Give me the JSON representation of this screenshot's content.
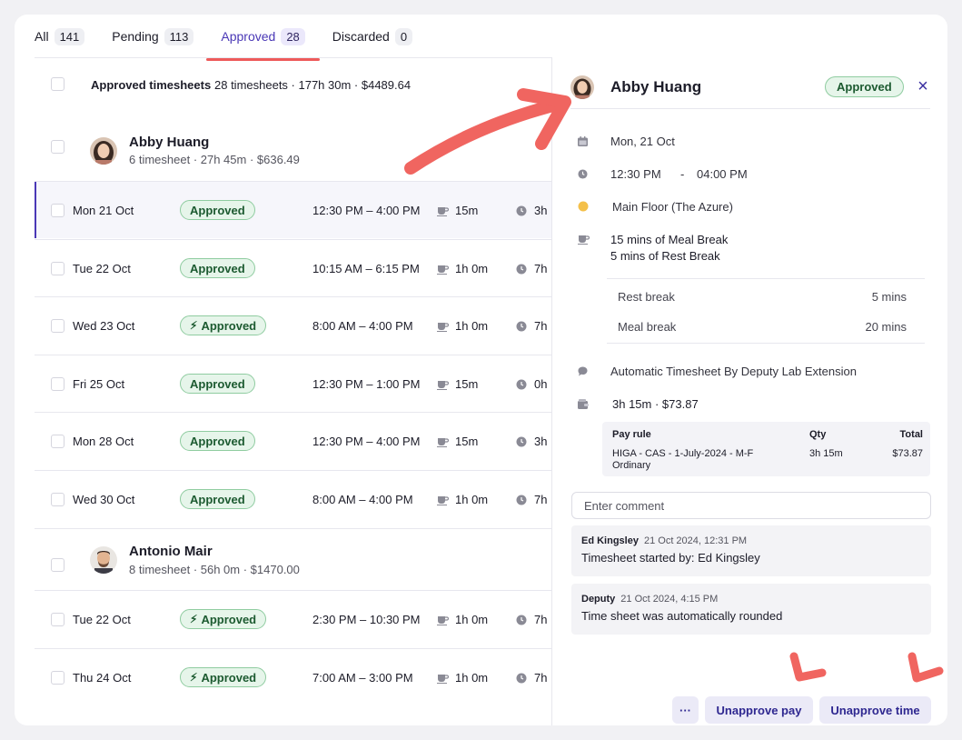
{
  "tabs": [
    {
      "label": "All",
      "count": "141"
    },
    {
      "label": "Pending",
      "count": "113"
    },
    {
      "label": "Approved",
      "count": "28"
    },
    {
      "label": "Discarded",
      "count": "0"
    }
  ],
  "summary": {
    "label": "Approved timesheets",
    "stats": "28 timesheets · 177h 30m · $4489.64"
  },
  "people": [
    {
      "name": "Abby Huang",
      "sub": "6 timesheet · 27h 45m · $636.49"
    },
    {
      "name": "Antonio Mair",
      "sub": "8 timesheet · 56h 0m · $1470.00"
    }
  ],
  "rows": [
    {
      "date": "Mon 21 Oct",
      "status": "Approved",
      "auto": false,
      "time": "12:30 PM – 4:00 PM",
      "break": "15m",
      "duration": "3h"
    },
    {
      "date": "Tue 22 Oct",
      "status": "Approved",
      "auto": false,
      "time": "10:15 AM – 6:15 PM",
      "break": "1h 0m",
      "duration": "7h"
    },
    {
      "date": "Wed 23 Oct",
      "status": "Approved",
      "auto": true,
      "time": "8:00 AM – 4:00 PM",
      "break": "1h 0m",
      "duration": "7h"
    },
    {
      "date": "Fri 25 Oct",
      "status": "Approved",
      "auto": false,
      "time": "12:30 PM – 1:00 PM",
      "break": "15m",
      "duration": "0h"
    },
    {
      "date": "Mon 28 Oct",
      "status": "Approved",
      "auto": false,
      "time": "12:30 PM – 4:00 PM",
      "break": "15m",
      "duration": "3h"
    },
    {
      "date": "Wed 30 Oct",
      "status": "Approved",
      "auto": false,
      "time": "8:00 AM – 4:00 PM",
      "break": "1h 0m",
      "duration": "7h"
    },
    {
      "date": "Tue 22 Oct",
      "status": "Approved",
      "auto": true,
      "time": "2:30 PM – 10:30 PM",
      "break": "1h 0m",
      "duration": "7h"
    },
    {
      "date": "Thu 24 Oct",
      "status": "Approved",
      "auto": true,
      "time": "7:00 AM – 3:00 PM",
      "break": "1h 0m",
      "duration": "7h"
    }
  ],
  "detail": {
    "name": "Abby Huang",
    "status": "Approved",
    "close": "×",
    "date": "Mon, 21 Oct",
    "start": "12:30 PM",
    "dash": "-",
    "end": "04:00 PM",
    "location": "Main Floor (The Azure)",
    "breaks_line1": "15 mins of Meal Break",
    "breaks_line2": "5 mins of Rest Break",
    "break_rows": [
      {
        "label": "Rest break",
        "value": "5 mins"
      },
      {
        "label": "Meal break",
        "value": "20 mins"
      }
    ],
    "note": "Automatic Timesheet By Deputy Lab Extension",
    "cost": "3h 15m  · $73.87",
    "pay_table": {
      "headers": {
        "rule": "Pay rule",
        "qty": "Qty",
        "total": "Total"
      },
      "rule_line1": "HIGA - CAS - 1-July-2024 - M-F",
      "rule_line2": "Ordinary",
      "qty": "3h 15m",
      "total": "$73.87"
    },
    "comment_placeholder": "Enter comment",
    "comments": [
      {
        "author": "Ed Kingsley",
        "when": "21 Oct 2024, 12:31 PM",
        "body": "Timesheet started by: Ed Kingsley"
      },
      {
        "author": "Deputy",
        "when": "21 Oct 2024, 4:15 PM",
        "body": "Time sheet was automatically rounded"
      }
    ],
    "buttons": {
      "more": "···",
      "unapprove_pay": "Unapprove pay",
      "unapprove_time": "Unapprove time"
    }
  },
  "colors": {
    "accent": "#4a38b6",
    "approved_bg": "#e6f5ea",
    "approved_border": "#8fcca0",
    "annotation": "#f06560"
  }
}
